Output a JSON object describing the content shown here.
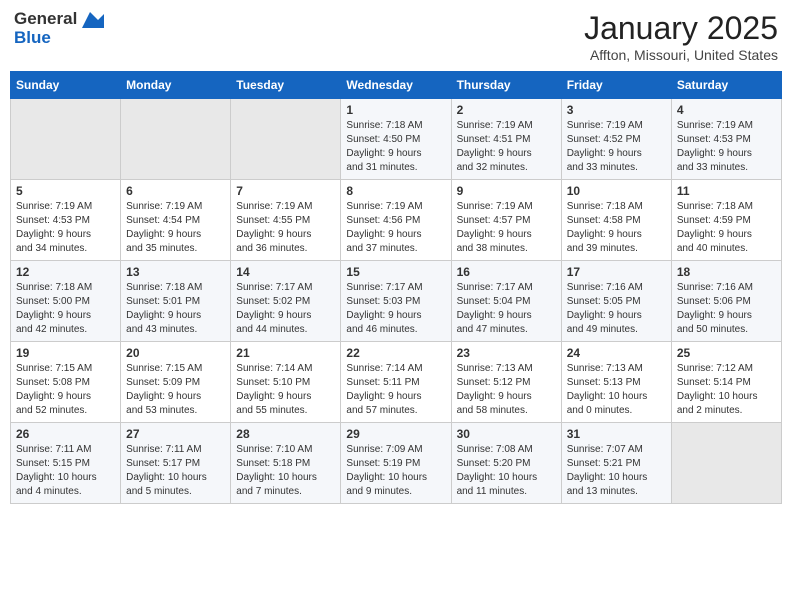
{
  "header": {
    "logo_general": "General",
    "logo_blue": "Blue",
    "month_title": "January 2025",
    "location": "Affton, Missouri, United States"
  },
  "weekdays": [
    "Sunday",
    "Monday",
    "Tuesday",
    "Wednesday",
    "Thursday",
    "Friday",
    "Saturday"
  ],
  "weeks": [
    {
      "days": [
        {
          "num": "",
          "info": "",
          "empty": true
        },
        {
          "num": "",
          "info": "",
          "empty": true
        },
        {
          "num": "",
          "info": "",
          "empty": true
        },
        {
          "num": "1",
          "info": "Sunrise: 7:18 AM\nSunset: 4:50 PM\nDaylight: 9 hours\nand 31 minutes."
        },
        {
          "num": "2",
          "info": "Sunrise: 7:19 AM\nSunset: 4:51 PM\nDaylight: 9 hours\nand 32 minutes."
        },
        {
          "num": "3",
          "info": "Sunrise: 7:19 AM\nSunset: 4:52 PM\nDaylight: 9 hours\nand 33 minutes."
        },
        {
          "num": "4",
          "info": "Sunrise: 7:19 AM\nSunset: 4:53 PM\nDaylight: 9 hours\nand 33 minutes."
        }
      ]
    },
    {
      "days": [
        {
          "num": "5",
          "info": "Sunrise: 7:19 AM\nSunset: 4:53 PM\nDaylight: 9 hours\nand 34 minutes."
        },
        {
          "num": "6",
          "info": "Sunrise: 7:19 AM\nSunset: 4:54 PM\nDaylight: 9 hours\nand 35 minutes."
        },
        {
          "num": "7",
          "info": "Sunrise: 7:19 AM\nSunset: 4:55 PM\nDaylight: 9 hours\nand 36 minutes."
        },
        {
          "num": "8",
          "info": "Sunrise: 7:19 AM\nSunset: 4:56 PM\nDaylight: 9 hours\nand 37 minutes."
        },
        {
          "num": "9",
          "info": "Sunrise: 7:19 AM\nSunset: 4:57 PM\nDaylight: 9 hours\nand 38 minutes."
        },
        {
          "num": "10",
          "info": "Sunrise: 7:18 AM\nSunset: 4:58 PM\nDaylight: 9 hours\nand 39 minutes."
        },
        {
          "num": "11",
          "info": "Sunrise: 7:18 AM\nSunset: 4:59 PM\nDaylight: 9 hours\nand 40 minutes."
        }
      ]
    },
    {
      "days": [
        {
          "num": "12",
          "info": "Sunrise: 7:18 AM\nSunset: 5:00 PM\nDaylight: 9 hours\nand 42 minutes."
        },
        {
          "num": "13",
          "info": "Sunrise: 7:18 AM\nSunset: 5:01 PM\nDaylight: 9 hours\nand 43 minutes."
        },
        {
          "num": "14",
          "info": "Sunrise: 7:17 AM\nSunset: 5:02 PM\nDaylight: 9 hours\nand 44 minutes."
        },
        {
          "num": "15",
          "info": "Sunrise: 7:17 AM\nSunset: 5:03 PM\nDaylight: 9 hours\nand 46 minutes."
        },
        {
          "num": "16",
          "info": "Sunrise: 7:17 AM\nSunset: 5:04 PM\nDaylight: 9 hours\nand 47 minutes."
        },
        {
          "num": "17",
          "info": "Sunrise: 7:16 AM\nSunset: 5:05 PM\nDaylight: 9 hours\nand 49 minutes."
        },
        {
          "num": "18",
          "info": "Sunrise: 7:16 AM\nSunset: 5:06 PM\nDaylight: 9 hours\nand 50 minutes."
        }
      ]
    },
    {
      "days": [
        {
          "num": "19",
          "info": "Sunrise: 7:15 AM\nSunset: 5:08 PM\nDaylight: 9 hours\nand 52 minutes."
        },
        {
          "num": "20",
          "info": "Sunrise: 7:15 AM\nSunset: 5:09 PM\nDaylight: 9 hours\nand 53 minutes."
        },
        {
          "num": "21",
          "info": "Sunrise: 7:14 AM\nSunset: 5:10 PM\nDaylight: 9 hours\nand 55 minutes."
        },
        {
          "num": "22",
          "info": "Sunrise: 7:14 AM\nSunset: 5:11 PM\nDaylight: 9 hours\nand 57 minutes."
        },
        {
          "num": "23",
          "info": "Sunrise: 7:13 AM\nSunset: 5:12 PM\nDaylight: 9 hours\nand 58 minutes."
        },
        {
          "num": "24",
          "info": "Sunrise: 7:13 AM\nSunset: 5:13 PM\nDaylight: 10 hours\nand 0 minutes."
        },
        {
          "num": "25",
          "info": "Sunrise: 7:12 AM\nSunset: 5:14 PM\nDaylight: 10 hours\nand 2 minutes."
        }
      ]
    },
    {
      "days": [
        {
          "num": "26",
          "info": "Sunrise: 7:11 AM\nSunset: 5:15 PM\nDaylight: 10 hours\nand 4 minutes."
        },
        {
          "num": "27",
          "info": "Sunrise: 7:11 AM\nSunset: 5:17 PM\nDaylight: 10 hours\nand 5 minutes."
        },
        {
          "num": "28",
          "info": "Sunrise: 7:10 AM\nSunset: 5:18 PM\nDaylight: 10 hours\nand 7 minutes."
        },
        {
          "num": "29",
          "info": "Sunrise: 7:09 AM\nSunset: 5:19 PM\nDaylight: 10 hours\nand 9 minutes."
        },
        {
          "num": "30",
          "info": "Sunrise: 7:08 AM\nSunset: 5:20 PM\nDaylight: 10 hours\nand 11 minutes."
        },
        {
          "num": "31",
          "info": "Sunrise: 7:07 AM\nSunset: 5:21 PM\nDaylight: 10 hours\nand 13 minutes."
        },
        {
          "num": "",
          "info": "",
          "empty": true
        }
      ]
    }
  ]
}
